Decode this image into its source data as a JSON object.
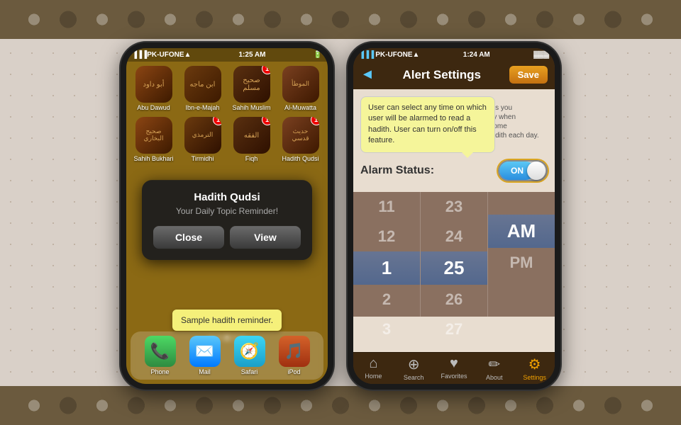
{
  "background": {
    "color": "#c8b89a"
  },
  "phone1": {
    "status_bar": {
      "carrier": "PK-UFONE",
      "time": "1:25 AM",
      "wifi": true
    },
    "apps": [
      {
        "label": "Abu Dawud",
        "badge": null
      },
      {
        "label": "Ibn-e-Majah",
        "badge": null
      },
      {
        "label": "Sahih Muslim",
        "badge": "1"
      },
      {
        "label": "Al-Muwatta",
        "badge": null
      },
      {
        "label": "Sahih Bukhari",
        "badge": null
      },
      {
        "label": "Tirmidhi",
        "badge": "1"
      },
      {
        "label": "Fiqh",
        "badge": "1"
      },
      {
        "label": "Hadith Qudsi",
        "badge": "1"
      }
    ],
    "popup": {
      "title": "Hadith Qudsi",
      "subtitle": "Your Daily Topic Reminder!",
      "close_btn": "Close",
      "view_btn": "View"
    },
    "sample_note": "Sample hadith reminder.",
    "dock": [
      {
        "label": "Phone",
        "icon": "📞"
      },
      {
        "label": "Mail",
        "icon": "✉️"
      },
      {
        "label": "Safari",
        "icon": "🧭"
      },
      {
        "label": "iPod",
        "icon": "🎵"
      }
    ]
  },
  "phone2": {
    "status_bar": {
      "carrier": "PK-UFONE",
      "time": "1:24 AM",
      "battery": "full"
    },
    "header": {
      "title": "Alert Settings",
      "save_btn": "Save",
      "back_arrow": "◄"
    },
    "tooltip": "User can select any time on which user will be alarmed to read a hadith. User can turn on/off this feature.",
    "description": "ts you y when ome hadith each day.",
    "alarm_status": {
      "label": "Alarm Status:",
      "state": "ON"
    },
    "time_picker": {
      "columns": [
        {
          "values": [
            "11",
            "12",
            "1",
            "2",
            "3"
          ],
          "selected_index": 2
        },
        {
          "values": [
            "23",
            "24",
            "25",
            "26",
            "27"
          ],
          "selected_index": 2
        },
        {
          "values": [
            "",
            "",
            "AM",
            "PM",
            ""
          ],
          "selected_index": 2
        }
      ]
    },
    "tabs": [
      {
        "label": "Home",
        "icon": "⌂",
        "active": false
      },
      {
        "label": "Search",
        "icon": "⊕",
        "active": false
      },
      {
        "label": "Favorites",
        "icon": "♥",
        "active": false
      },
      {
        "label": "About",
        "icon": "✏",
        "active": false
      },
      {
        "label": "Settings",
        "icon": "⚙",
        "active": true
      }
    ]
  }
}
